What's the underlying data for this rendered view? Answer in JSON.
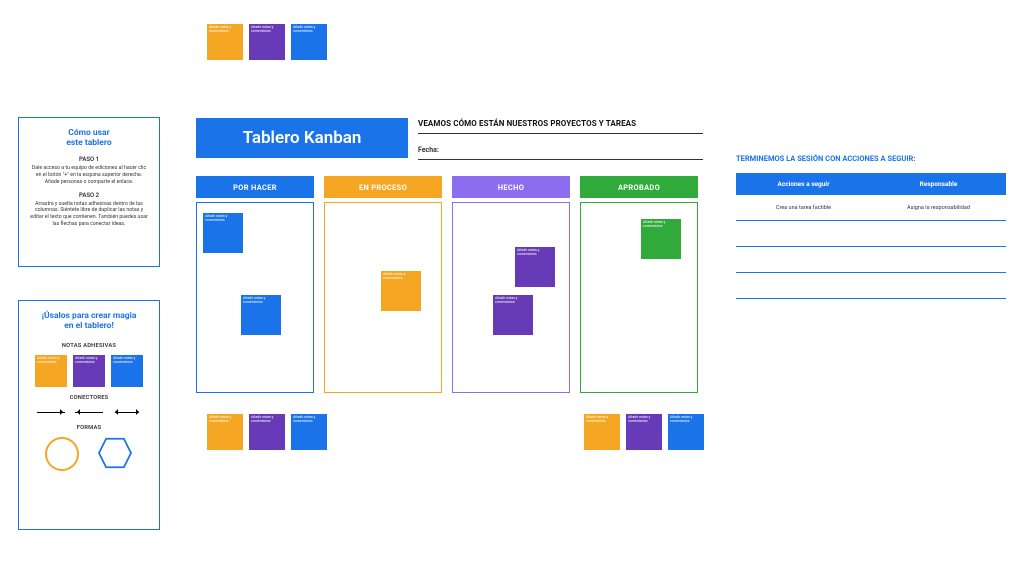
{
  "sticky_text": "Añadir notas y comentarios",
  "howto": {
    "title": "Cómo usar\neste tablero",
    "step1_label": "PASO 1",
    "step1_body": "Dale acceso a tu equipo de ediciones al hacer clic en el botón \"+\" en la esquina superior derecha. Añade personas o comparte el enlace.",
    "step2_label": "PASO 2",
    "step2_body": "Arrastra y suelta notas adhesivas dentro de las columnas. Siéntete libre de duplicar las notas y editar el texto que contienen. También puedes usar las flechas para conectar ideas."
  },
  "magic": {
    "title": "¡Úsalos para crear magia\nen el tablero!",
    "sticky_label": "NOTAS ADHESIVAS",
    "connectors_label": "CONECTORES",
    "shapes_label": "FORMAS"
  },
  "kanban": {
    "title": "Tablero Kanban",
    "subtitle": "VEAMOS CÓMO ESTÁN NUESTROS PROYECTOS Y TAREAS",
    "fecha_label": "Fecha:",
    "columns": [
      "POR HACER",
      "EN PROCESO",
      "HECHO",
      "APROBADO"
    ]
  },
  "actions": {
    "title": "TERMINEMOS LA SESIÓN CON ACCIONES A SEGUIR:",
    "headers": [
      "Acciones a seguir",
      "Responsable"
    ],
    "rows": [
      [
        "Crea una tarea factible",
        "Asigna la responsabilidad"
      ],
      [
        "",
        ""
      ],
      [
        "",
        ""
      ],
      [
        "",
        ""
      ]
    ]
  },
  "colors": {
    "blue": "#1a73e8",
    "orange": "#f5a623",
    "purple": "#673ab7",
    "lilac": "#8e6cef",
    "green": "#2faa3b"
  }
}
